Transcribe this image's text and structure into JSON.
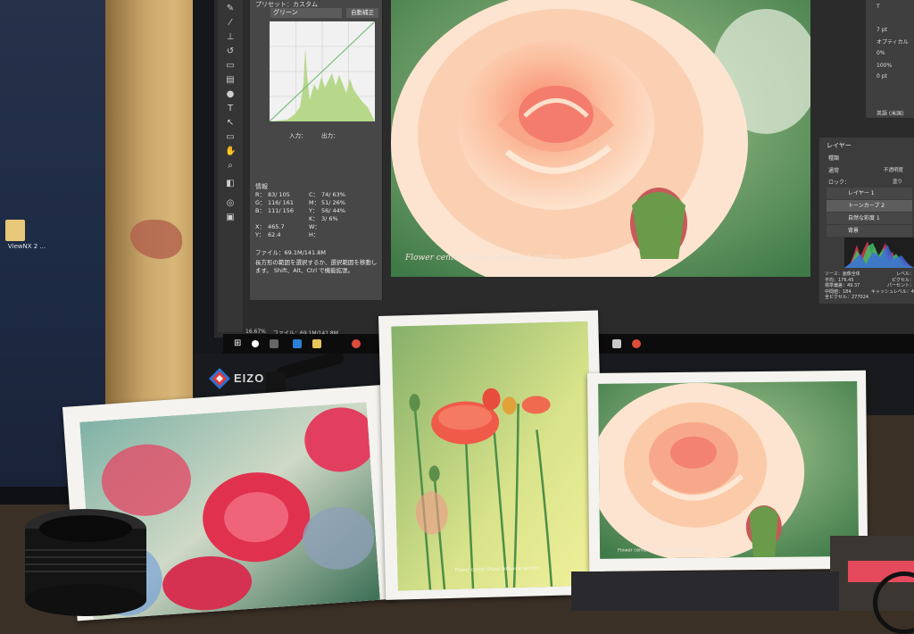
{
  "photoshop": {
    "curves": {
      "title": "プリセット：カスタム",
      "preset": "グリーン",
      "auto_button": "自動補正",
      "input_label": "入力：",
      "output_label": "出力："
    },
    "info": {
      "title": "情報",
      "rows": [
        [
          "R：",
          "83/ 105",
          "C：",
          "74/ 63%"
        ],
        [
          "G：",
          "116/ 161",
          "M：",
          "51/ 26%"
        ],
        [
          "B：",
          "111/ 156",
          "Y：",
          "56/ 44%"
        ],
        [
          "",
          "",
          "K：",
          "3/ 6%"
        ],
        [
          "X：",
          "465.7",
          "W：",
          ""
        ],
        [
          "Y：",
          "62.4",
          "H：",
          ""
        ]
      ],
      "file_size": "ファイル：69.1M/141.8M",
      "help_text": "長方形の範囲を選択するか、選択範囲を移動します。 Shift、Alt、Ctrl で機能拡張。"
    },
    "status": {
      "zoom": "16.67%",
      "file": "ファイル：69.1M/141.8M"
    },
    "canvas_caption": "Flower center Ofuna botanical garden",
    "properties": [
      "T",
      "7 pt",
      "オプティカル",
      "0%",
      "100%",
      "0 pt",
      "英語 (米国)"
    ],
    "layers": {
      "title": "レイヤー",
      "kind": "種類",
      "blend": "通常",
      "opacity": "不透明度",
      "lock": "ロック：",
      "fill": "塗り",
      "items": [
        "レイヤー 1",
        "トーンカーブ 2",
        "自然な彩度 1",
        "背景"
      ]
    },
    "histogram_stats": [
      "ソース：画像全体",
      "平均：176.45",
      "標準偏差：49.37",
      "中間値：184",
      "全ピクセル：277024",
      "レベル：",
      "ピクセル：",
      "パーセント：",
      "キャッシュレベル：4"
    ]
  },
  "desktop_icon_label": "ViewNX 2 ...",
  "monitor_brand": "EIZO",
  "prints": {
    "middle_caption": "Flower center Ofuna botanical garden",
    "right_caption": "Flower center Ofuna botanical garden"
  },
  "colors": {
    "rose": "#f6b08e",
    "poppy": "#f05a48",
    "pink_rose": "#e2344e",
    "canvas_green": "#5a8a56"
  }
}
